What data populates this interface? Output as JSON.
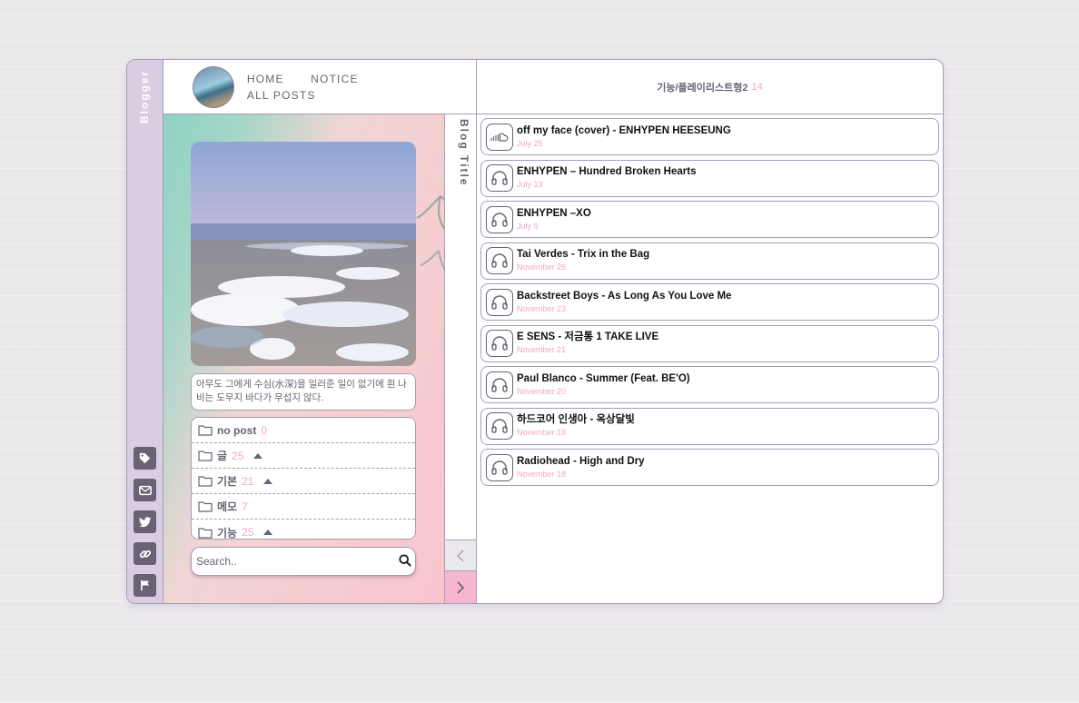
{
  "sidebar": {
    "title": "Blogger",
    "icons": [
      "tag-icon",
      "mail-icon",
      "twitter-icon",
      "link-icon",
      "flag-icon"
    ]
  },
  "header": {
    "nav": [
      "HOME",
      "NOTICE",
      "ALL POSTS"
    ]
  },
  "right_header": {
    "title": "기능/플레이리스트형2",
    "count": "14"
  },
  "intro": {
    "quote": "아무도 그에게 수심(水深)을 일러준 일이 없기에 흰 나비는 도무지 바다가 무섭지 않다."
  },
  "categories": [
    {
      "label": "no post",
      "count": "0",
      "expandable": false
    },
    {
      "label": "글",
      "count": "25",
      "expandable": true
    },
    {
      "label": "기본",
      "count": "21",
      "expandable": true
    },
    {
      "label": "메모",
      "count": "7",
      "expandable": false
    },
    {
      "label": "기능",
      "count": "25",
      "expandable": true
    }
  ],
  "search": {
    "placeholder": "Search.."
  },
  "blog_title": "Blog Title",
  "posts": [
    {
      "title": "off my face (cover) - ENHYPEN HEESEUNG",
      "date": "July 25",
      "icon": "soundcloud-icon"
    },
    {
      "title": "ENHYPEN – Hundred Broken Hearts",
      "date": "July 13",
      "icon": "headphones-icon"
    },
    {
      "title": "ENHYPEN –XO",
      "date": "July 9",
      "icon": "headphones-icon"
    },
    {
      "title": "Tai Verdes - Trix in the Bag",
      "date": "November 26",
      "icon": "headphones-icon"
    },
    {
      "title": "Backstreet Boys - As Long As You Love Me",
      "date": "November 23",
      "icon": "headphones-icon"
    },
    {
      "title": "E SENS - 저금통 1 TAKE LIVE",
      "date": "November 21",
      "icon": "headphones-icon"
    },
    {
      "title": "Paul Blanco - Summer (Feat. BE'O)",
      "date": "November 20",
      "icon": "headphones-icon"
    },
    {
      "title": "하드코어 인생아 - 옥상달빛",
      "date": "November 19",
      "icon": "headphones-icon"
    },
    {
      "title": "Radiohead - High and Dry",
      "date": "November 18",
      "icon": "headphones-icon"
    }
  ],
  "colors": {
    "accent_pink": "#f7a6c3",
    "frame_border": "#a99bb8",
    "text_muted": "#6a6174",
    "strip_bg": "#d8cde1"
  }
}
